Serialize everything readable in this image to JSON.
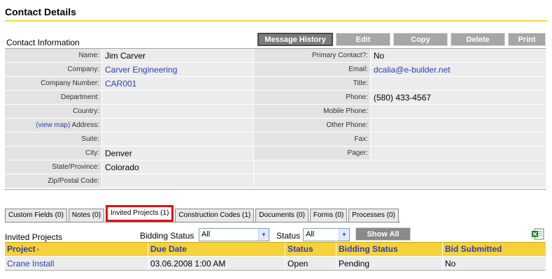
{
  "page_title": "Contact Details",
  "section_title": "Contact Information",
  "toolbar": {
    "message_history": "Message History",
    "edit": "Edit",
    "copy": "Copy",
    "delete": "Delete",
    "print": "Print"
  },
  "fields": {
    "name_label": "Name:",
    "name_value": "Jim Carver",
    "company_label": "Company:",
    "company_value": "Carver Engineering",
    "company_number_label": "Company Number:",
    "company_number_value": "CAR001",
    "department_label": "Department:",
    "country_label": "Country:",
    "view_map": "(view map)",
    "address_label": "Address:",
    "suite_label": "Suite:",
    "city_label": "City:",
    "city_value": "Denver",
    "state_label": "State/Province:",
    "state_value": "Colorado",
    "zip_label": "Zip/Postal Code:",
    "primary_contact_label": "Primary Contact?:",
    "primary_contact_value": "No",
    "email_label": "Email:",
    "email_value": "dcalia@e-builder.net",
    "title_label": "Title:",
    "phone_label": "Phone:",
    "phone_value": "(580) 433-4567",
    "mobile_label": "Mobile Phone:",
    "other_phone_label": "Other Phone:",
    "fax_label": "Fax:",
    "pager_label": "Pager:"
  },
  "tabs": [
    {
      "label": "Custom Fields (0)"
    },
    {
      "label": "Notes (0)"
    },
    {
      "label": "Invited Projects (1)"
    },
    {
      "label": "Construction Codes (1)"
    },
    {
      "label": "Documents (0)"
    },
    {
      "label": "Forms (0)"
    },
    {
      "label": "Processes (0)"
    }
  ],
  "invited": {
    "title": "Invited Projects",
    "bidding_status_label": "Bidding Status",
    "bidding_status_value": "All",
    "status_label": "Status",
    "status_value": "All",
    "show_all": "Show All"
  },
  "grid": {
    "headers": [
      "Project",
      "Due Date",
      "Status",
      "Bidding Status",
      "Bid Submitted"
    ],
    "sort_indicator": "▲",
    "rows": [
      [
        "Crane Install",
        "03.06.2008 1:00 AM",
        "Open",
        "Pending",
        "No"
      ]
    ]
  },
  "colors": {
    "accent_yellow": "#f5d13c",
    "link_blue": "#2b3fb0",
    "active_tab_border": "#e01010"
  }
}
